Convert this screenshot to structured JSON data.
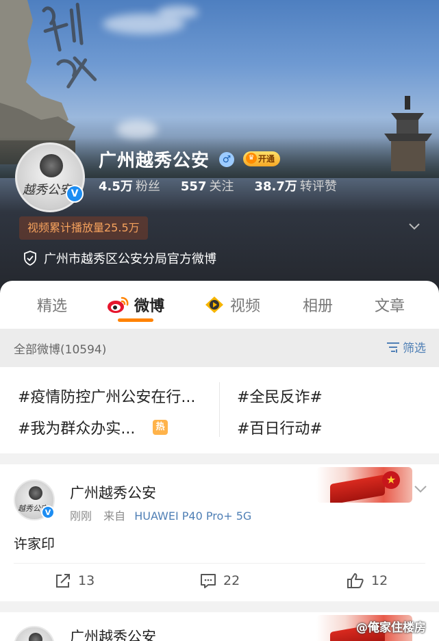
{
  "profile": {
    "name": "广州越秀公安",
    "gender_icon": "male-icon",
    "vip_badge": "开通",
    "verified_icon": "verified-v-icon",
    "stats": [
      {
        "value": "4.5万",
        "label": "粉丝"
      },
      {
        "value": "557",
        "label": "关注"
      },
      {
        "value": "38.7万",
        "label": "转评赞"
      }
    ],
    "video_views": "视频累计播放量25.5万",
    "verification": "广州市越秀区公安分局官方微博"
  },
  "tabs": [
    {
      "label": "精选",
      "icon": ""
    },
    {
      "label": "微博",
      "icon": "weibo-icon",
      "active": true
    },
    {
      "label": "视频",
      "icon": "video-icon"
    },
    {
      "label": "相册",
      "icon": ""
    },
    {
      "label": "文章",
      "icon": ""
    }
  ],
  "filter": {
    "all_posts": "全部微博(10594)",
    "filter_label": "筛选"
  },
  "topics": [
    "#疫情防控广州公安在行...",
    "#全民反诈#",
    "#我为群众办实...",
    "#百日行动#"
  ],
  "hot_badge": "热",
  "posts": [
    {
      "author": "广州越秀公安",
      "time": "刚刚",
      "source_prefix": "来自",
      "device": "HUAWEI P40 Pro+ 5G",
      "text": "许家印",
      "reposts": "13",
      "comments": "22",
      "likes": "12"
    },
    {
      "author": "广州越秀公安"
    }
  ],
  "watermark": "@俺家住楼房",
  "colors": {
    "accent": "#ff8200",
    "link": "#4f7fb5",
    "verified": "#1d8df2"
  }
}
